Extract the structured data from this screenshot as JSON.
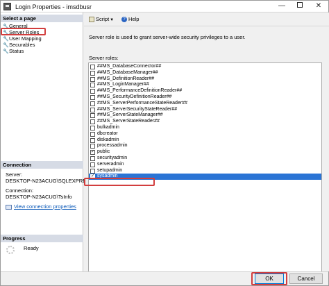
{
  "window": {
    "title": "Login Properties - imsdbusr",
    "minimize": "—",
    "close": "✕"
  },
  "left": {
    "select_page_header": "Select a page",
    "pages": [
      "General",
      "Server Roles",
      "User Mapping",
      "Securables",
      "Status"
    ],
    "selected_page": "Server Roles",
    "connection_header": "Connection",
    "server_label": "Server:",
    "server_value": "DESKTOP-N23ACUG\\SQLEXPRES",
    "connection_label": "Connection:",
    "connection_value": "DESKTOP-N23ACUG\\TsInfo",
    "view_conn_link": "View connection properties",
    "progress_header": "Progress",
    "progress_status": "Ready"
  },
  "toolbar": {
    "script_label": "Script",
    "help_label": "Help"
  },
  "main": {
    "description": "Server role is used to grant server-wide security privileges to a user.",
    "roles_label": "Server roles:",
    "roles": [
      {
        "name": "##MS_DatabaseConnector##",
        "checked": false
      },
      {
        "name": "##MS_DatabaseManager##",
        "checked": false
      },
      {
        "name": "##MS_DefinitionReader##",
        "checked": false
      },
      {
        "name": "##MS_LoginManager##",
        "checked": false
      },
      {
        "name": "##MS_PerformanceDefinitionReader##",
        "checked": false
      },
      {
        "name": "##MS_SecurityDefinitionReader##",
        "checked": false
      },
      {
        "name": "##MS_ServerPerformanceStateReader##",
        "checked": false
      },
      {
        "name": "##MS_ServerSecurityStateReader##",
        "checked": false
      },
      {
        "name": "##MS_ServerStateManager##",
        "checked": false
      },
      {
        "name": "##MS_ServerStateReader##",
        "checked": false
      },
      {
        "name": "bulkadmin",
        "checked": false
      },
      {
        "name": "dbcreator",
        "checked": false
      },
      {
        "name": "diskadmin",
        "checked": false
      },
      {
        "name": "processadmin",
        "checked": false
      },
      {
        "name": "public",
        "checked": true
      },
      {
        "name": "securityadmin",
        "checked": false
      },
      {
        "name": "serveradmin",
        "checked": false
      },
      {
        "name": "setupadmin",
        "checked": false
      },
      {
        "name": "sysadmin",
        "checked": true,
        "selected": true
      }
    ]
  },
  "buttons": {
    "ok": "OK",
    "cancel": "Cancel"
  },
  "colors": {
    "highlight": "#2a74d5",
    "annotation": "#d23d3d",
    "section_header": "#d6dbe5",
    "link": "#0a58b8"
  }
}
